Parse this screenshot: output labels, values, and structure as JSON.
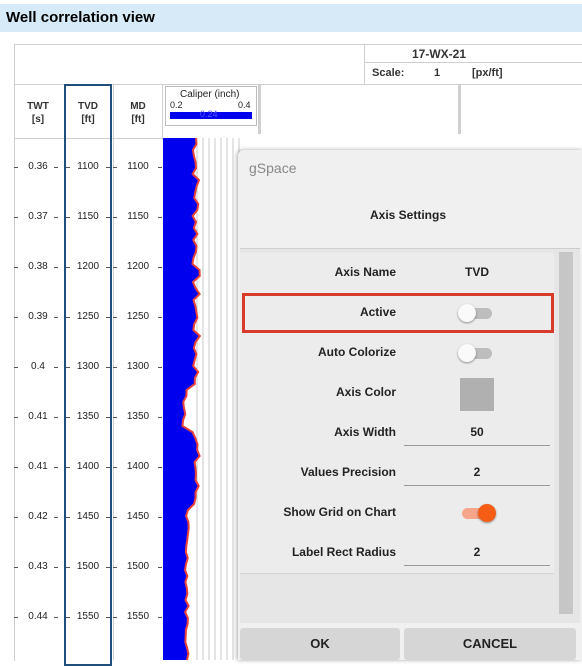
{
  "window": {
    "title": "Well correlation view"
  },
  "well_header": {
    "name": "17-WX-21",
    "scale_label": "Scale:",
    "scale_value": "1",
    "scale_unit": "[px/ft]"
  },
  "columns": {
    "twt": {
      "title": "TWT",
      "unit": "[s]"
    },
    "tvd": {
      "title": "TVD",
      "unit": "[ft]"
    },
    "md": {
      "title": "MD",
      "unit": "[ft]"
    }
  },
  "track": {
    "title": "Caliper (inch)",
    "min": "0.2",
    "max": "0.4",
    "current": "0.24",
    "curve_color": "#e8413a",
    "fill_color": "#0000ee"
  },
  "depth_ticks": {
    "twt": [
      "0.36",
      "0.37",
      "0.38",
      "0.39",
      "0.4",
      "0.41",
      "0.41",
      "0.42",
      "0.43",
      "0.44"
    ],
    "tvd": [
      "1100",
      "1150",
      "1200",
      "1250",
      "1300",
      "1350",
      "1400",
      "1450",
      "1500",
      "1550"
    ],
    "md": [
      "1100",
      "1150",
      "1200",
      "1250",
      "1300",
      "1350",
      "1400",
      "1450",
      "1500",
      "1550"
    ]
  },
  "dialog": {
    "app_name": "gSpace",
    "title": "Axis Settings",
    "rows": [
      {
        "label": "Axis Name",
        "type": "text",
        "value": "TVD"
      },
      {
        "label": "Active",
        "type": "toggle",
        "on": false
      },
      {
        "label": "Auto Colorize",
        "type": "toggle",
        "on": false
      },
      {
        "label": "Axis Color",
        "type": "color",
        "color": "#b0b0b0"
      },
      {
        "label": "Axis Width",
        "type": "input",
        "value": "50"
      },
      {
        "label": "Values Precision",
        "type": "input",
        "value": "2"
      },
      {
        "label": "Show Grid on Chart",
        "type": "toggle",
        "on": true
      },
      {
        "label": "Label Rect Radius",
        "type": "input",
        "value": "2"
      }
    ],
    "ok_label": "OK",
    "cancel_label": "CANCEL",
    "accent": "#f45d13",
    "highlight_color": "#d83b2a"
  }
}
